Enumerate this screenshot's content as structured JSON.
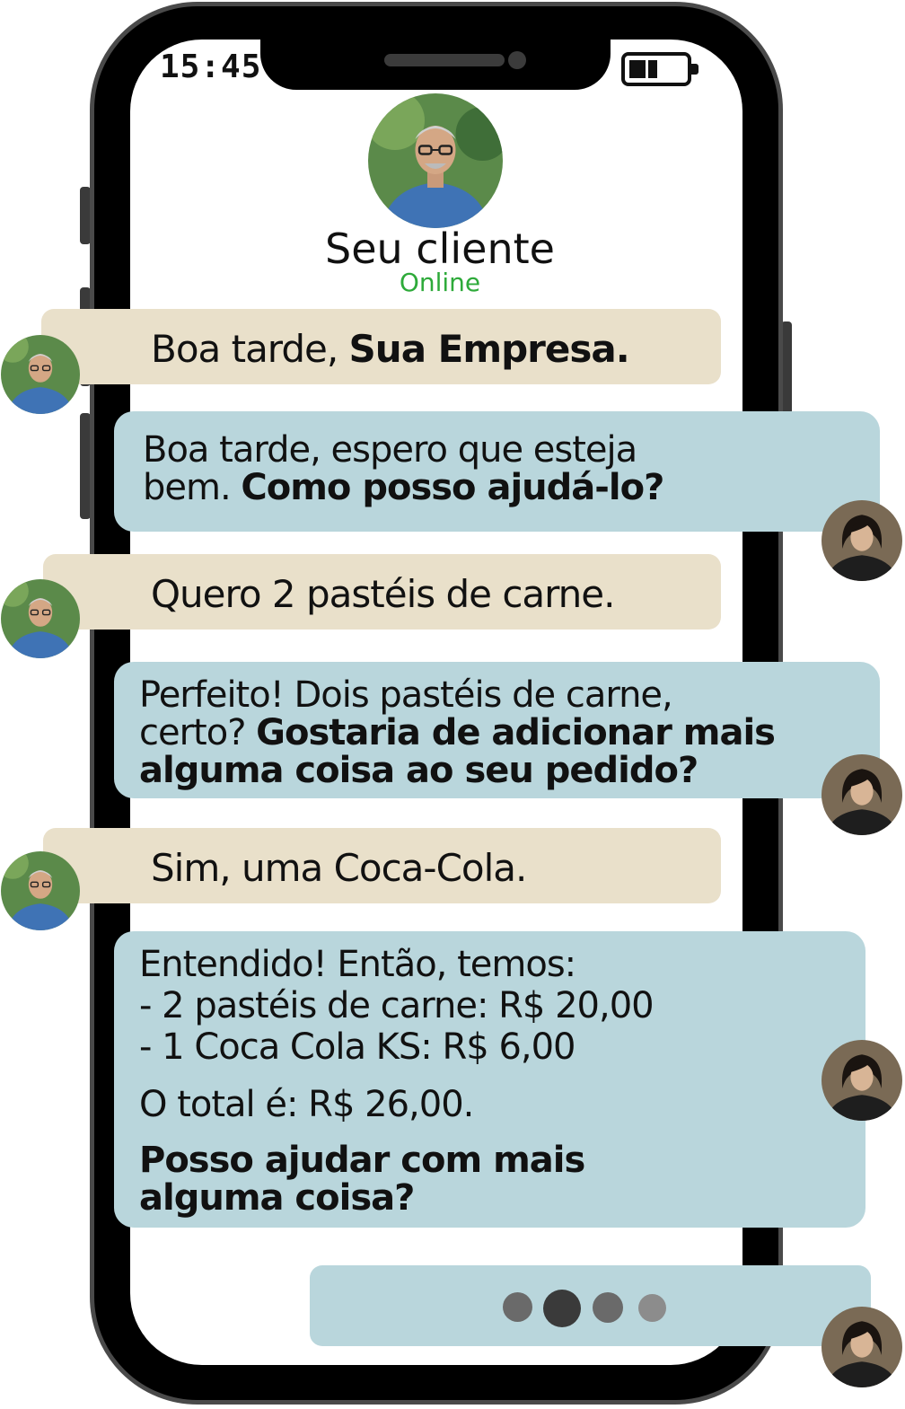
{
  "status_bar": {
    "time": "15:45"
  },
  "contact": {
    "name": "Seu cliente",
    "status": "Online",
    "status_color": "#2eaa3a"
  },
  "colors": {
    "incoming_bubble": "#e9e0ca",
    "outgoing_bubble": "#b9d6dc"
  },
  "messages": [
    {
      "sender": "customer",
      "normal": "Boa tarde, ",
      "bold": "Sua Empresa."
    },
    {
      "sender": "business",
      "line1": "Boa tarde, espero que esteja",
      "line2_normal": "bem. ",
      "line2_bold": "Como posso ajudá-lo?"
    },
    {
      "sender": "customer",
      "text": "Quero 2 pastéis de carne."
    },
    {
      "sender": "business",
      "line1": "Perfeito! Dois pastéis de carne,",
      "line2_normal": "certo? ",
      "line2_bold": "Gostaria de adicionar mais",
      "line3_bold": "alguma coisa ao seu pedido?"
    },
    {
      "sender": "customer",
      "text": "Sim, uma Coca-Cola."
    },
    {
      "sender": "business",
      "line1": "Entendido! Então, temos:",
      "line2": "- 2 pastéis de carne: R$ 20,00",
      "line3": "- 1 Coca Cola KS: R$ 6,00",
      "line4": "O total é: R$ 26,00.",
      "line5_bold": "Posso ajudar com mais",
      "line6_bold": "alguma coisa?"
    }
  ],
  "typing_indicator": {
    "dots": 4
  }
}
